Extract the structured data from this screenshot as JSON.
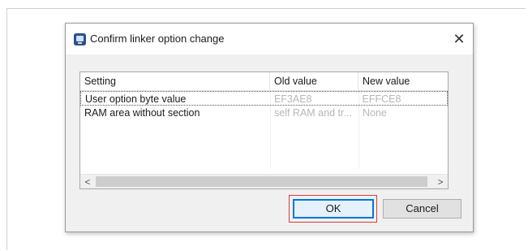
{
  "dialog": {
    "title": "Confirm linker option change",
    "close_glyph": "✕",
    "icon": "app-icon"
  },
  "table": {
    "columns": [
      "Setting",
      "Old value",
      "New value"
    ],
    "rows": [
      {
        "setting": "User option byte value",
        "old": "EF3AE8",
        "new": "EFFCE8",
        "selected": true
      },
      {
        "setting": "RAM area without section",
        "old": "self RAM and tr...",
        "new": "None",
        "selected": false
      }
    ]
  },
  "scrollbar": {
    "left_arrow": "<",
    "right_arrow": ">"
  },
  "buttons": {
    "ok_label": "OK",
    "cancel_label": "Cancel"
  },
  "colors": {
    "highlight": "#d93c3c",
    "focus": "#0078d7",
    "muted_text": "#b7b7b7"
  }
}
